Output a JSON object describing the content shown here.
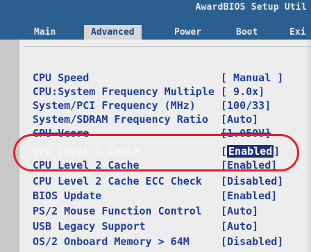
{
  "window": {
    "title": "AwardBIOS Setup Util"
  },
  "menu": {
    "items": [
      {
        "label": "Main",
        "active": false
      },
      {
        "label": "Advanced",
        "active": true
      },
      {
        "label": "Power",
        "active": false
      },
      {
        "label": "Boot",
        "active": false
      },
      {
        "label": "Exi",
        "active": false
      }
    ]
  },
  "settings": [
    {
      "label": "CPU Speed",
      "value": "[   Manual ]"
    },
    {
      "label": "CPU:System Frequency Multiple",
      "value": "[ 9.0x]"
    },
    {
      "label": "System/PCI Frequency (MHz)",
      "value": "[100/33]"
    },
    {
      "label": "System/SDRAM Frequency Ratio",
      "value": "[Auto]"
    },
    {
      "label": "CPU Vcore",
      "value": "[1.050V]"
    },
    {
      "label": "CPU Level 1 Cache",
      "value_prefix": "[",
      "value_selected": "Enabled",
      "value_suffix": "]"
    },
    {
      "label": "CPU Level 2 Cache",
      "value": "[Enabled]"
    },
    {
      "label": "CPU Level 2 Cache ECC Check",
      "value": "[Disabled]"
    },
    {
      "label": "BIOS Update",
      "value": "[Enabled]"
    },
    {
      "label": "PS/2 Mouse Function Control",
      "value": "[Auto]"
    },
    {
      "label": "USB Legacy Support",
      "value": "[Auto]"
    },
    {
      "label": "OS/2 Onboard Memory > 64M",
      "value": "[Disabled]"
    }
  ],
  "colors": {
    "header_blue": "#2b5f8f",
    "menu_text": "#e8e8e8",
    "active_tab_bg": "#d6d6d6",
    "setting_text": "#213f99",
    "selected_bg": "#1c2f7c",
    "annotation_red": "#e21f2e"
  }
}
